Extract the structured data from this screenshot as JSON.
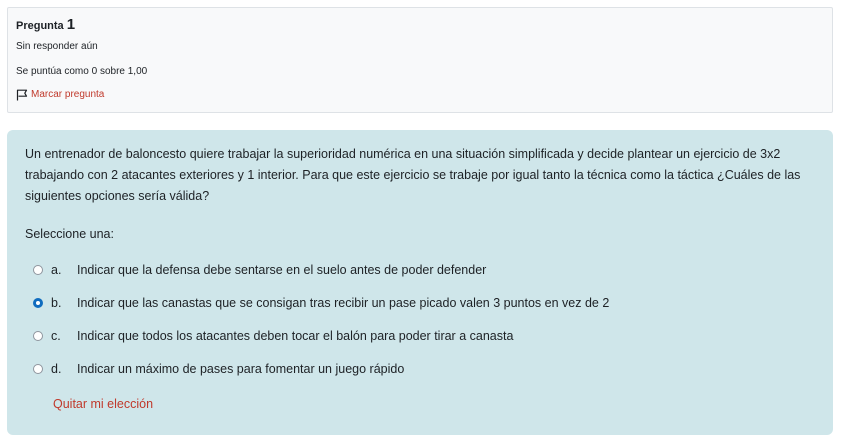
{
  "info": {
    "question_label": "Pregunta",
    "question_number": "1",
    "state": "Sin responder aún",
    "grade": "Se puntúa como 0 sobre 1,00",
    "flag_label": "Marcar pregunta",
    "flag_icon": "flag-outline"
  },
  "question": {
    "text": "Un entrenador de baloncesto quiere trabajar la superioridad numérica en una situación simplificada y decide plantear un ejercicio de 3x2 trabajando con 2 atacantes exteriores y 1 interior. Para que este ejercicio se trabaje por igual tanto la técnica como la táctica ¿Cuáles de las siguientes opciones sería válida?",
    "prompt": "Seleccione una:",
    "selected_index": 1,
    "answers": [
      {
        "letter": "a.",
        "text": "Indicar que la defensa debe sentarse en el suelo antes de poder defender"
      },
      {
        "letter": "b.",
        "text": "Indicar que las canastas que se consigan tras recibir un pase picado valen 3 puntos en vez de 2"
      },
      {
        "letter": "c.",
        "text": "Indicar que todos los atacantes deben tocar el balón para poder tirar a canasta"
      },
      {
        "letter": "d.",
        "text": "Indicar un máximo de pases para fomentar un juego rápido"
      }
    ],
    "clear_label": "Quitar mi elección"
  },
  "colors": {
    "content_bg": "#cfe6ea",
    "link_red": "#c0392b",
    "radio_selected": "#0f6cbf"
  }
}
